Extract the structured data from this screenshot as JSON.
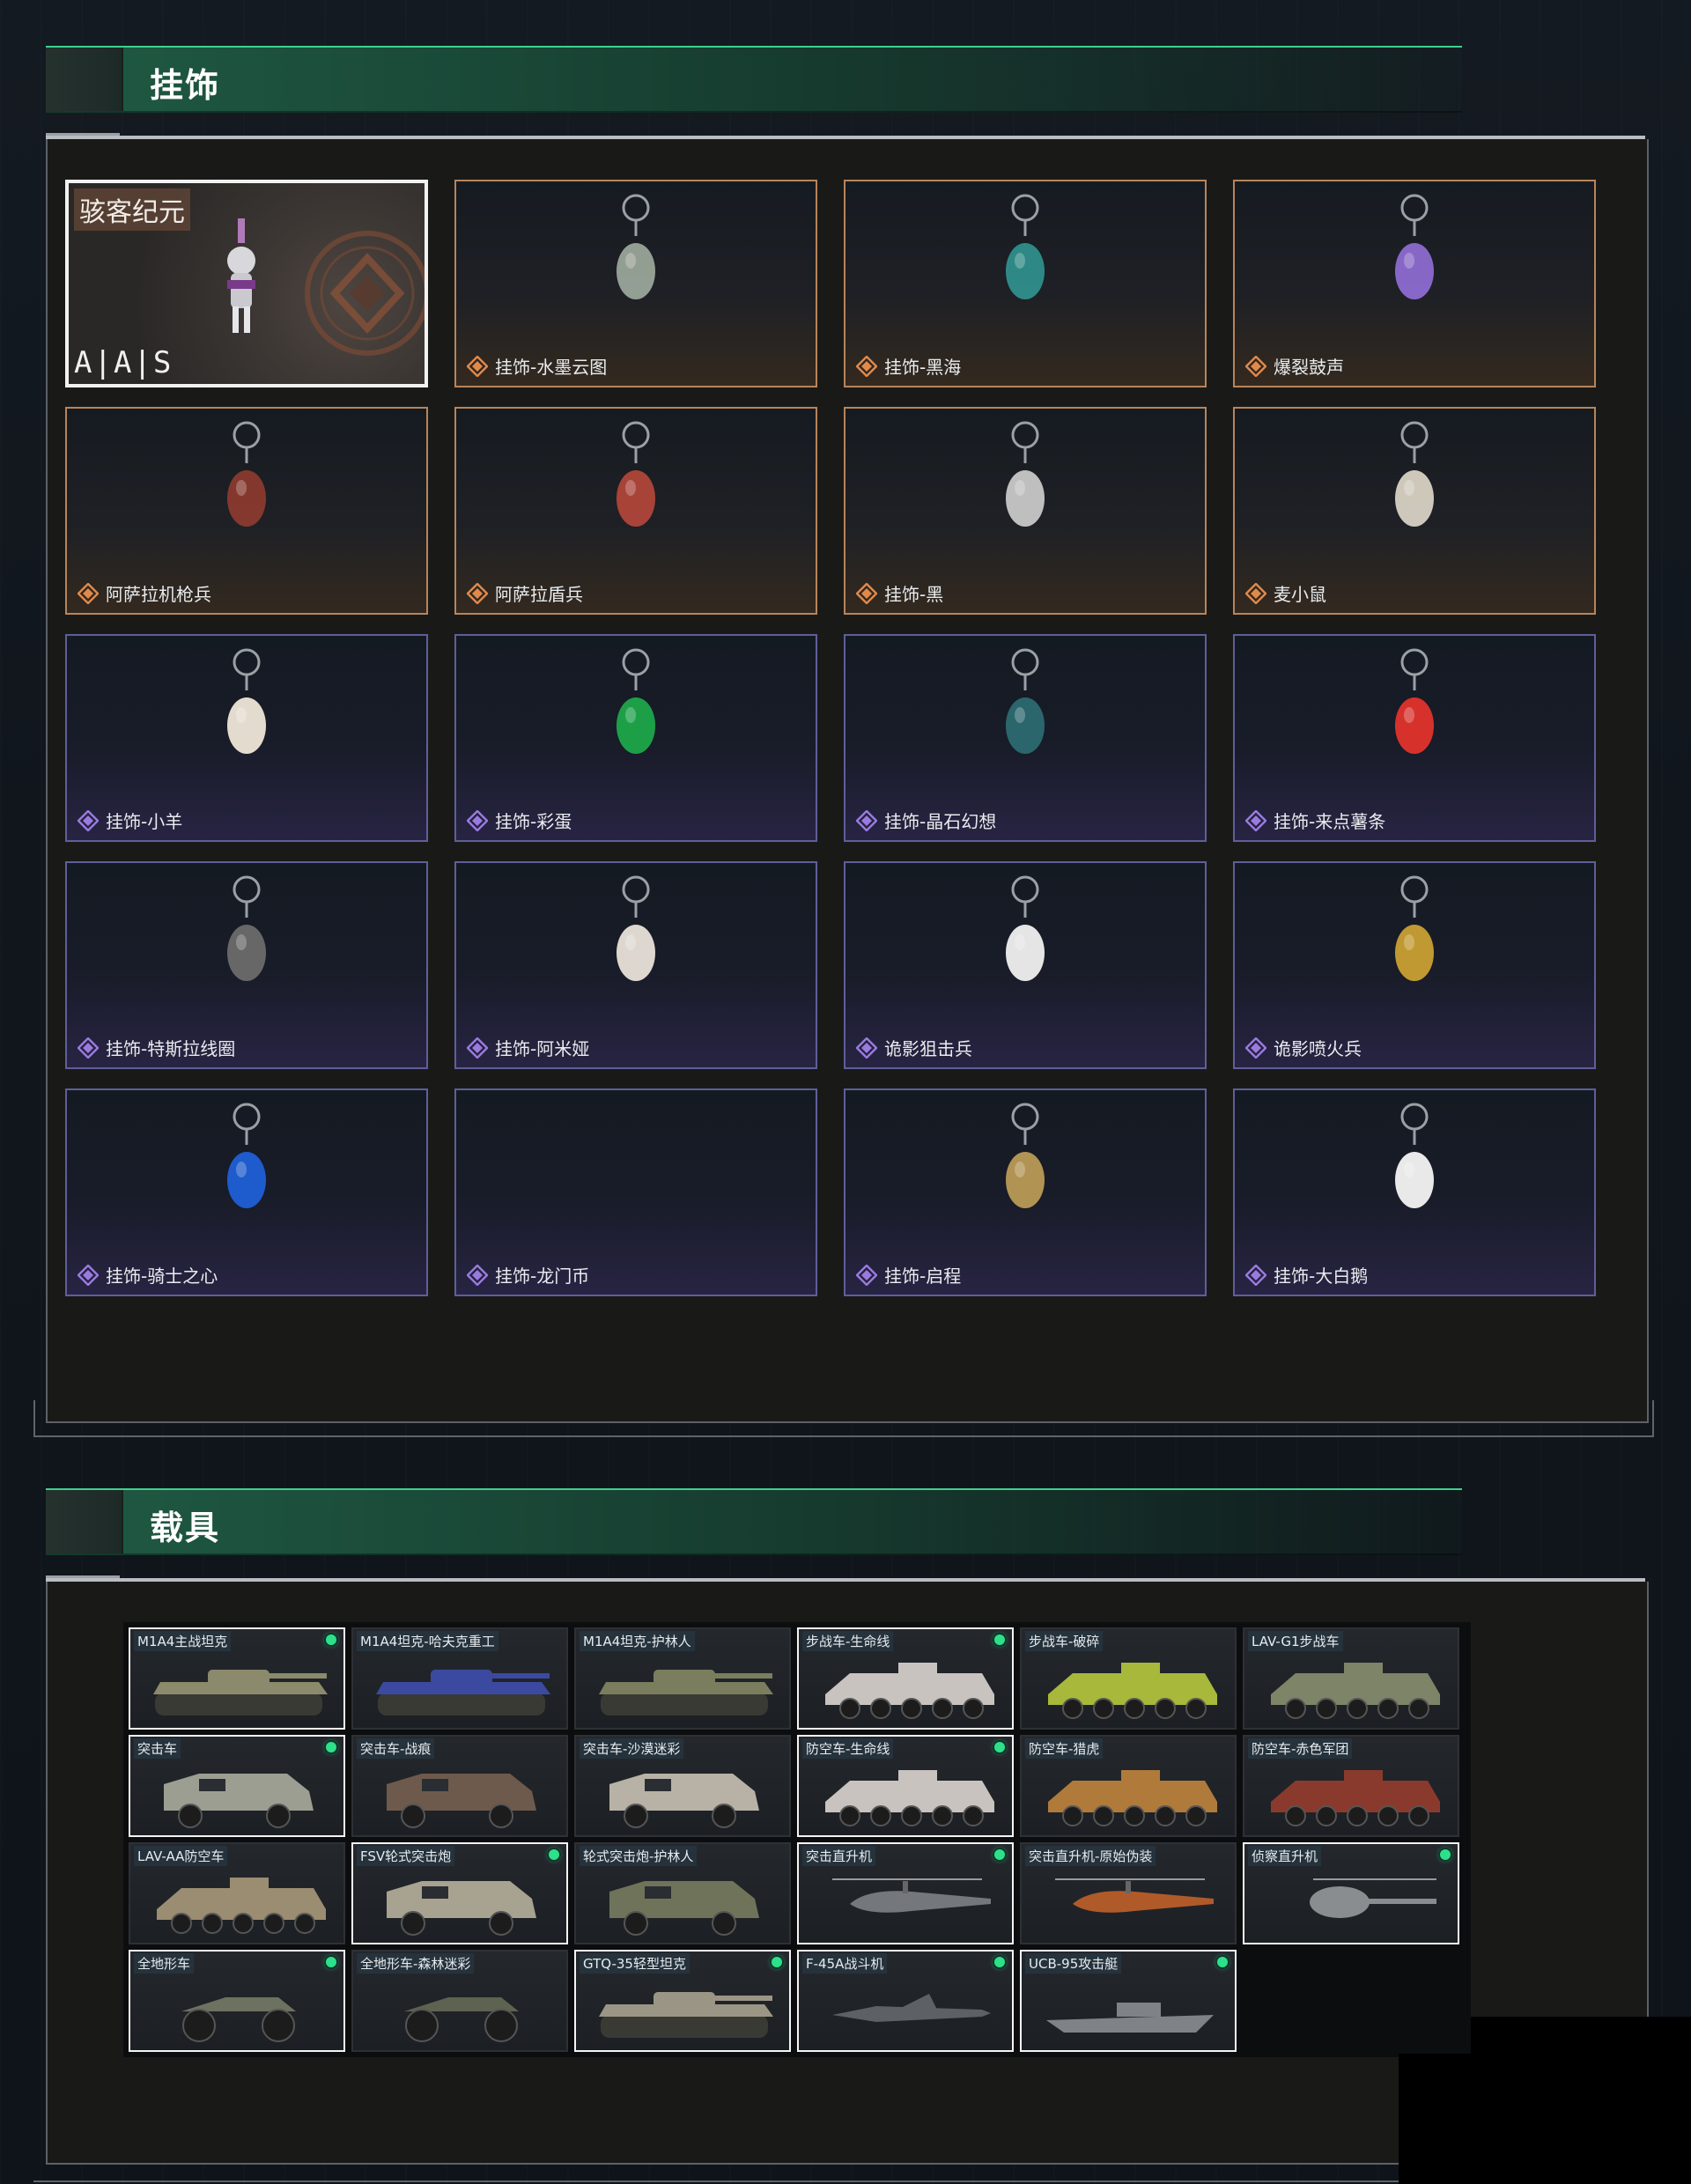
{
  "sections": {
    "charms_title": "挂饰",
    "vehicles_title": "载具"
  },
  "featured": {
    "tag": "骇客纪元",
    "brand": "A|A|S"
  },
  "charms": [
    {
      "label": "挂饰-水墨云图",
      "rarity": "gold",
      "icon": "ink-cloud-ball-charm-icon",
      "color": "#9aa59a"
    },
    {
      "label": "挂饰-黑海",
      "rarity": "gold",
      "icon": "anchor-charm-icon",
      "color": "#2f8f8c"
    },
    {
      "label": "爆裂鼓声",
      "rarity": "gold",
      "icon": "drummer-girl-charm-icon",
      "color": "#8d6bd0"
    },
    {
      "label": "阿萨拉机枪兵",
      "rarity": "gold",
      "icon": "machine-gunner-charm-icon",
      "color": "#8a3a2e"
    },
    {
      "label": "阿萨拉盾兵",
      "rarity": "gold",
      "icon": "shield-soldier-charm-icon",
      "color": "#b0463a"
    },
    {
      "label": "挂饰-黑",
      "rarity": "gold",
      "icon": "blade-charm-icon",
      "color": "#c8c8c8"
    },
    {
      "label": "麦小鼠",
      "rarity": "gold",
      "icon": "mouse-charm-icon",
      "color": "#d8d2c4"
    },
    {
      "label": "挂饰-小羊",
      "rarity": "purple",
      "icon": "sheep-charm-icon",
      "color": "#efe6d8"
    },
    {
      "label": "挂饰-彩蛋",
      "rarity": "purple",
      "icon": "easter-egg-charm-icon",
      "color": "#1da64a"
    },
    {
      "label": "挂饰-晶石幻想",
      "rarity": "purple",
      "icon": "crystal-cube-charm-icon",
      "color": "#2c6a70"
    },
    {
      "label": "挂饰-来点薯条",
      "rarity": "purple",
      "icon": "fries-charm-icon",
      "color": "#e0342b"
    },
    {
      "label": "挂饰-特斯拉线圈",
      "rarity": "purple",
      "icon": "tesla-coil-charm-icon",
      "color": "#6b6b6b"
    },
    {
      "label": "挂饰-阿米娅",
      "rarity": "purple",
      "icon": "rabbit-charm-icon",
      "color": "#e8e2d8"
    },
    {
      "label": "诡影狙击兵",
      "rarity": "purple",
      "icon": "sniper-duck-charm-icon",
      "color": "#f0f0f0"
    },
    {
      "label": "诡影喷火兵",
      "rarity": "purple",
      "icon": "flamethrower-charm-icon",
      "color": "#c9a033"
    },
    {
      "label": "挂饰-骑士之心",
      "rarity": "purple",
      "icon": "knight-heart-charm-icon",
      "color": "#1f5fd6"
    },
    {
      "label": "挂饰-龙门币",
      "rarity": "purple",
      "icon": "",
      "color": ""
    },
    {
      "label": "挂饰-启程",
      "rarity": "purple",
      "icon": "coin-charm-icon",
      "color": "#b99a55"
    },
    {
      "label": "挂饰-大白鹅",
      "rarity": "purple",
      "icon": "goose-charm-icon",
      "color": "#f4f4f4"
    }
  ],
  "vehicles": [
    {
      "label": "M1A4主战坦克",
      "owned": true,
      "kind": "tank",
      "color": "#8b8a6c"
    },
    {
      "label": "M1A4坦克-哈夫克重工",
      "owned": false,
      "kind": "tank",
      "color": "#3b4aa0"
    },
    {
      "label": "M1A4坦克-护林人",
      "owned": false,
      "kind": "tank",
      "color": "#7a7e5e"
    },
    {
      "label": "步战车-生命线",
      "owned": true,
      "kind": "ifv",
      "color": "#c9c3c0"
    },
    {
      "label": "步战车-破碎",
      "owned": false,
      "kind": "ifv",
      "color": "#a8b83a"
    },
    {
      "label": "LAV-G1步战车",
      "owned": false,
      "kind": "ifv",
      "color": "#7d8468"
    },
    {
      "label": "突击车",
      "owned": true,
      "kind": "assault",
      "color": "#9c9e92"
    },
    {
      "label": "突击车-战痕",
      "owned": false,
      "kind": "assault",
      "color": "#6e5a4c"
    },
    {
      "label": "突击车-沙漠迷彩",
      "owned": false,
      "kind": "assault",
      "color": "#b8b2a6"
    },
    {
      "label": "防空车-生命线",
      "owned": true,
      "kind": "ifv",
      "color": "#c9c3c0"
    },
    {
      "label": "防空车-猎虎",
      "owned": false,
      "kind": "ifv",
      "color": "#b07a3a"
    },
    {
      "label": "防空车-赤色军团",
      "owned": false,
      "kind": "ifv",
      "color": "#8a3a2c"
    },
    {
      "label": "LAV-AA防空车",
      "owned": false,
      "kind": "ifv",
      "color": "#9b8d72"
    },
    {
      "label": "FSV轮式突击炮",
      "owned": true,
      "kind": "assault",
      "color": "#a8a290"
    },
    {
      "label": "轮式突击炮-护林人",
      "owned": false,
      "kind": "assault",
      "color": "#6f7359"
    },
    {
      "label": "突击直升机",
      "owned": true,
      "kind": "heli",
      "color": "#74787c"
    },
    {
      "label": "突击直升机-原始伪装",
      "owned": false,
      "kind": "heli",
      "color": "#b05a2a"
    },
    {
      "label": "侦察直升机",
      "owned": true,
      "kind": "smallheli",
      "color": "#8a8d90"
    },
    {
      "label": "全地形车",
      "owned": true,
      "kind": "atv",
      "color": "#6d7260"
    },
    {
      "label": "全地形车-森林迷彩",
      "owned": false,
      "kind": "atv",
      "color": "#5e6250"
    },
    {
      "label": "GTQ-35轻型坦克",
      "owned": true,
      "kind": "tank",
      "color": "#9b9585"
    },
    {
      "label": "F-45A战斗机",
      "owned": true,
      "kind": "jet",
      "color": "#5d6166"
    },
    {
      "label": "UCB-95攻击艇",
      "owned": true,
      "kind": "boat",
      "color": "#7f8388"
    }
  ],
  "colors": {
    "accent_green": "#3fd08e",
    "gold_border": "#b8845a",
    "purple_border": "#5f5e9a",
    "owned_dot": "#2ee08a"
  }
}
